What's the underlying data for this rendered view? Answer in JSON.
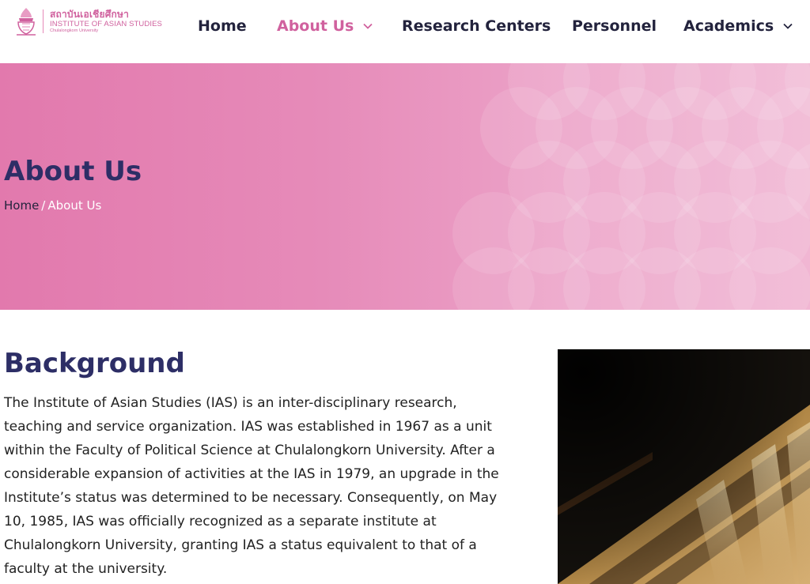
{
  "header": {
    "logo": {
      "thai_name": "สถาบันเอเชียศึกษา",
      "english_name": "INSTITUTE OF ASIAN STUDIES",
      "university": "Chulalongkorn University"
    },
    "nav": [
      {
        "label": "Home",
        "has_dropdown": false,
        "active": false
      },
      {
        "label": "About Us",
        "has_dropdown": true,
        "active": true
      },
      {
        "label": "Research Centers",
        "has_dropdown": false,
        "active": false
      },
      {
        "label": "Personnel",
        "has_dropdown": false,
        "active": false
      },
      {
        "label": "Academics",
        "has_dropdown": true,
        "active": false
      }
    ]
  },
  "hero": {
    "title": "About Us",
    "breadcrumb": {
      "home": "Home",
      "separator": "/",
      "current": "About Us"
    }
  },
  "main": {
    "section_title": "Background",
    "paragraph_lines": [
      "The Institute of Asian Studies (IAS) is an inter-disciplinary research,",
      "teaching and service organization. IAS was established in 1967 as a unit",
      "within the Faculty of Political Science at Chulalongkorn University. After a",
      "considerable expansion of activities at the IAS in 1979, an upgrade in the",
      "Institute’s status was determined to be necessary. Consequently, on May",
      "10, 1985, IAS was officially recognized as a separate institute at",
      "Chulalongkorn University, granting IAS a status equivalent to that of a",
      "faculty at the university."
    ]
  },
  "colors": {
    "brand_pink": "#d0619e",
    "heading_navy": "#2d2e66",
    "nav_text": "#23233d",
    "hero_gradient_start": "#e279ad",
    "hero_gradient_end": "#f1b6d3"
  }
}
